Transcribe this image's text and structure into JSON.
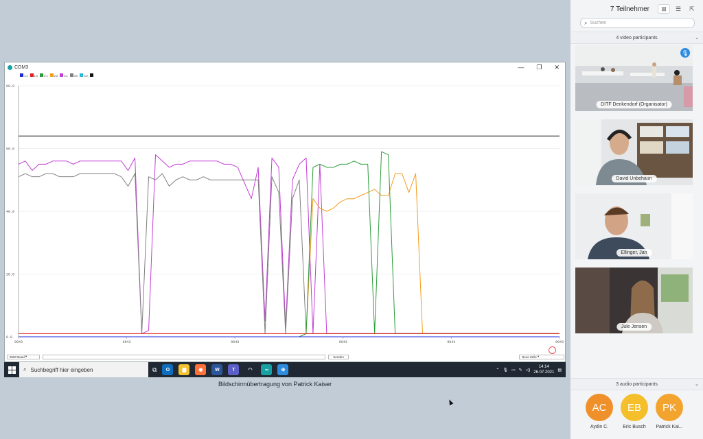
{
  "plotter": {
    "title": "COM3",
    "window_controls": [
      "—",
      "❐",
      "✕"
    ],
    "legend": [
      {
        "label": "1:1",
        "color": "#1f2bd8"
      },
      {
        "label": "1:0",
        "color": "#e0201e"
      },
      {
        "label": "2:1",
        "color": "#2c9b3a"
      },
      {
        "label": "2:0",
        "color": "#f39c1c"
      },
      {
        "label": "3:1",
        "color": "#c33cd6"
      },
      {
        "label": "3:0",
        "color": "#808080"
      },
      {
        "label": "3:2",
        "color": "#25b9d9"
      },
      {
        "label": "",
        "color": "#111111"
      }
    ],
    "y_ticks": [
      "80.0",
      "60.0",
      "40.0",
      "20.0",
      "0.0"
    ],
    "x_ticks": [
      "9043",
      "9043",
      "9043",
      "9043",
      "9043",
      "9043"
    ],
    "baud": "9600 Baud",
    "send_label": "Senden",
    "line_ending": "Neue Zeile"
  },
  "chart_data": {
    "type": "line",
    "ylim": [
      0,
      80
    ],
    "x": [
      0,
      10,
      20,
      30,
      40,
      50,
      60,
      70,
      80,
      90,
      100,
      110,
      120,
      130,
      140,
      150,
      160,
      170,
      180,
      190,
      200,
      210,
      220,
      230,
      240,
      250,
      260,
      270,
      280,
      290,
      300,
      310,
      320,
      330,
      340,
      350,
      360,
      370,
      380,
      390,
      400,
      410,
      420,
      430,
      440,
      450,
      460,
      470,
      480,
      490,
      500,
      510,
      520,
      530,
      540,
      550,
      560,
      570,
      580,
      590,
      600,
      610,
      620,
      630,
      640,
      650,
      660,
      670,
      680,
      690,
      700,
      710,
      720,
      730,
      740,
      750,
      760,
      770,
      780,
      790
    ],
    "series": [
      {
        "color": "#111111",
        "values": [
          64,
          64,
          64,
          64,
          64,
          64,
          64,
          64,
          64,
          64,
          64,
          64,
          64,
          64,
          64,
          64,
          64,
          64,
          64,
          64,
          64,
          64,
          64,
          64,
          64,
          64,
          64,
          64,
          64,
          64,
          64,
          64,
          64,
          64,
          64,
          64,
          64,
          64,
          64,
          64,
          64,
          64,
          64,
          64,
          64,
          64,
          64,
          64,
          64,
          64,
          64,
          64,
          64,
          64,
          64,
          64,
          64,
          64,
          64,
          64,
          64,
          64,
          64,
          64,
          64,
          64,
          64,
          64,
          64,
          64,
          64,
          64,
          64,
          64,
          64,
          64,
          64,
          64,
          64,
          64
        ]
      },
      {
        "color": "#c33cd6",
        "values": [
          55,
          56,
          53,
          55,
          55,
          56,
          56,
          56,
          55,
          56,
          56,
          56,
          56,
          56,
          56,
          56,
          53,
          57,
          1,
          2,
          58,
          56,
          54,
          55,
          55,
          56,
          56,
          56,
          56,
          56,
          55,
          55,
          54,
          49,
          44,
          54,
          5,
          57,
          54,
          3,
          50,
          55,
          57,
          1,
          55,
          1,
          1,
          1,
          1,
          1,
          1,
          1,
          1,
          1,
          1,
          1,
          1,
          1,
          1,
          1,
          1,
          1,
          1,
          1,
          1,
          1,
          1,
          1,
          1,
          1,
          1,
          1,
          1,
          1,
          1,
          1,
          1,
          1,
          1,
          1
        ]
      },
      {
        "color": "#808080",
        "values": [
          51,
          52,
          51,
          51,
          52,
          52,
          51,
          51,
          51,
          52,
          52,
          52,
          52,
          52,
          52,
          51,
          48,
          52,
          1,
          51,
          50,
          52,
          48,
          50,
          51,
          50,
          50,
          51,
          50,
          50,
          50,
          50,
          50,
          50,
          50,
          50,
          1,
          51,
          46,
          1,
          44,
          50,
          1,
          1,
          1,
          1,
          1,
          1,
          1,
          1,
          1,
          1,
          1,
          1,
          1,
          1,
          1,
          1,
          1,
          1,
          1,
          1,
          1,
          1,
          1,
          1,
          1,
          1,
          1,
          1,
          1,
          1,
          1,
          1,
          1,
          1,
          1,
          1,
          1,
          1
        ]
      },
      {
        "color": "#f39c1c",
        "values": [
          0,
          0,
          0,
          0,
          0,
          0,
          0,
          0,
          0,
          0,
          0,
          0,
          0,
          0,
          0,
          0,
          0,
          0,
          0,
          0,
          0,
          0,
          0,
          0,
          0,
          0,
          0,
          0,
          0,
          0,
          0,
          0,
          0,
          0,
          0,
          0,
          0,
          0,
          0,
          0,
          0,
          0,
          1,
          44,
          41,
          40,
          41,
          43,
          44,
          44,
          45,
          46,
          47,
          45,
          45,
          52,
          52,
          46,
          52,
          1,
          1,
          1,
          1,
          1,
          1,
          1,
          1,
          1,
          1,
          1,
          1,
          1,
          1,
          1,
          1,
          1,
          1,
          1,
          1,
          1
        ]
      },
      {
        "color": "#2c9b3a",
        "values": [
          0,
          0,
          0,
          0,
          0,
          0,
          0,
          0,
          0,
          0,
          0,
          0,
          0,
          0,
          0,
          0,
          0,
          0,
          0,
          0,
          0,
          0,
          0,
          0,
          0,
          0,
          0,
          0,
          0,
          0,
          0,
          0,
          0,
          0,
          0,
          0,
          0,
          0,
          0,
          0,
          0,
          0,
          1,
          54,
          55,
          54,
          54,
          55,
          55,
          56,
          55,
          55,
          1,
          59,
          58,
          1,
          1,
          1,
          1,
          1,
          1,
          1,
          1,
          1,
          1,
          1,
          1,
          1,
          1,
          1,
          1,
          1,
          1,
          1,
          1,
          1,
          1,
          1,
          1,
          1
        ]
      },
      {
        "color": "#e0201e",
        "values": [
          1,
          1,
          1,
          1,
          1,
          1,
          1,
          1,
          1,
          1,
          1,
          1,
          1,
          1,
          1,
          1,
          1,
          1,
          1,
          1,
          1,
          1,
          1,
          1,
          1,
          1,
          1,
          1,
          1,
          1,
          1,
          1,
          1,
          1,
          1,
          1,
          1,
          1,
          1,
          1,
          1,
          1,
          1,
          1,
          1,
          1,
          1,
          1,
          1,
          1,
          1,
          1,
          1,
          1,
          1,
          1,
          1,
          1,
          1,
          1,
          1,
          1,
          1,
          1,
          1,
          1,
          1,
          1,
          1,
          1,
          1,
          1,
          1,
          1,
          1,
          1,
          1,
          1,
          1,
          1
        ]
      },
      {
        "color": "#1f2bd8",
        "values": [
          0,
          0,
          0,
          0,
          0,
          0,
          0,
          0,
          0,
          0,
          0,
          0,
          0,
          0,
          0,
          0,
          0,
          0,
          0,
          0,
          0,
          0,
          0,
          0,
          0,
          0,
          0,
          0,
          0,
          0,
          0,
          0,
          0,
          0,
          0,
          0,
          0,
          0,
          0,
          0,
          0,
          0,
          0,
          0,
          0,
          0,
          0,
          0,
          0,
          0,
          0,
          0,
          0,
          0,
          0,
          0,
          0,
          0,
          0,
          0,
          0,
          0,
          0,
          0,
          0,
          0,
          0,
          0,
          0,
          0,
          0,
          0,
          0,
          0,
          0,
          0,
          0,
          0,
          0,
          0
        ]
      }
    ]
  },
  "taskbar": {
    "search_placeholder": "Suchbegriff hier eingeben",
    "apps": [
      {
        "label": "O",
        "color": "#0f6cbd"
      },
      {
        "label": "▆",
        "color": "#f2c230"
      },
      {
        "label": "◉",
        "color": "#ff7139"
      },
      {
        "label": "W",
        "color": "#2b579a"
      },
      {
        "label": "T",
        "color": "#5b5fc7"
      },
      {
        "label": "◠",
        "color": "#202833"
      },
      {
        "label": "∞",
        "color": "#17a1a5"
      },
      {
        "label": "⊕",
        "color": "#2d8ce0"
      }
    ],
    "time": "14:14",
    "date": "26.07.2021"
  },
  "caption": "Bildschirmübertragung von Patrick Kaiser",
  "panel": {
    "title": "7 Teilnehmer",
    "search_placeholder": "Suchen",
    "video_section": "4 video participants",
    "video_participants": [
      {
        "name": "DITF Denkendorf (Organisator)"
      },
      {
        "name": "David Unbehaun"
      },
      {
        "name": "Ellinger, Jan"
      },
      {
        "name": "Jule Jensen"
      }
    ],
    "audio_section": "3 audio participants",
    "audio_participants": [
      {
        "initials": "AC",
        "name": "Aydin C.",
        "color": "#f0902a"
      },
      {
        "initials": "EB",
        "name": "Eric Busch",
        "color": "#f4bf2a"
      },
      {
        "initials": "PK",
        "name": "Patrick Kai...",
        "color": "#f3a42f"
      }
    ]
  }
}
